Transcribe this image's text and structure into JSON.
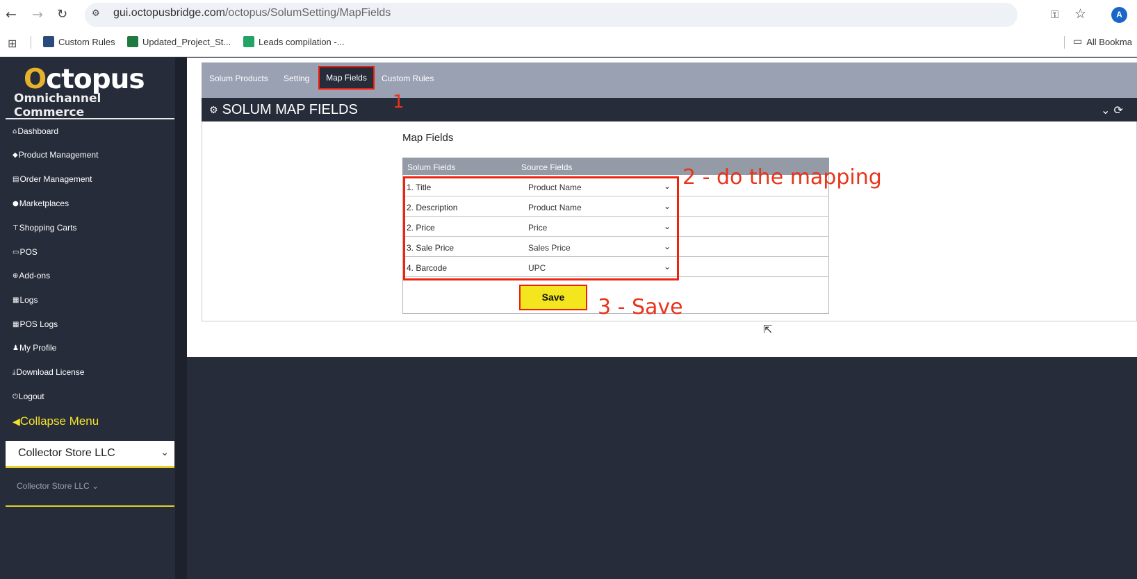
{
  "browser": {
    "url_host": "gui.octopusbridge.com",
    "url_path": "/octopus/SolumSetting/MapFields",
    "avatar_letter": "A",
    "icons": [
      "back-arrow-icon",
      "forward-arrow-icon",
      "reload-icon",
      "site-info-icon",
      "key-icon",
      "star-icon",
      "apps-grid-icon",
      "folder-icon"
    ],
    "bookmarks": [
      {
        "label": "Custom Rules",
        "icon": "octopus-icon",
        "color": "#2a4a7a"
      },
      {
        "label": "Updated_Project_St...",
        "icon": "excel-icon",
        "color": "#1f7a3f"
      },
      {
        "label": "Leads compilation -...",
        "icon": "sheets-icon",
        "color": "#21a464"
      }
    ],
    "all_bookmarks": "All Bookma"
  },
  "brand": {
    "title_lead": "",
    "title_o": "O",
    "title_rest": "ctopus",
    "subtitle": "Omnichannel Commerce",
    "accent": "#e7b22b"
  },
  "sidebar": {
    "items": [
      {
        "label": "Dashboard",
        "icon": "home-icon"
      },
      {
        "label": "Product Management",
        "icon": "tag-icon"
      },
      {
        "label": "Order Management",
        "icon": "list-icon"
      },
      {
        "label": "Marketplaces",
        "icon": "globe-icon"
      },
      {
        "label": "Shopping Carts",
        "icon": "cart-icon"
      },
      {
        "label": "POS",
        "icon": "laptop-icon"
      },
      {
        "label": "Add-ons",
        "icon": "plus-circle-icon"
      },
      {
        "label": "Logs",
        "icon": "file-icon"
      },
      {
        "label": "POS Logs",
        "icon": "file-icon"
      },
      {
        "label": "My Profile",
        "icon": "user-icon"
      },
      {
        "label": "Download License",
        "icon": "download-icon"
      },
      {
        "label": "Logout",
        "icon": "power-icon"
      }
    ],
    "collapse_label": "Collapse Menu",
    "store_selected": "Collector Store LLC",
    "store_secondary": "Collector Store LLC"
  },
  "tabs": {
    "items": [
      "Solum Products",
      "Setting",
      "Map Fields",
      "Custom Rules"
    ],
    "active": "Map Fields"
  },
  "panel": {
    "title": "SOLUM MAP FIELDS"
  },
  "map": {
    "heading": "Map Fields",
    "col_solum": "Solum Fields",
    "col_source": "Source Fields",
    "rows": [
      {
        "field": "1. Title",
        "source": "Product Name"
      },
      {
        "field": "2. Description",
        "source": "Product Name"
      },
      {
        "field": "2. Price",
        "source": "Price"
      },
      {
        "field": "3. Sale Price",
        "source": "Sales Price"
      },
      {
        "field": "4. Barcode",
        "source": "UPC"
      }
    ],
    "save_label": "Save"
  },
  "annotations": {
    "step1": "1",
    "step2": "2 - do the mapping",
    "step3": "3 - Save",
    "color": "#e8341a"
  }
}
